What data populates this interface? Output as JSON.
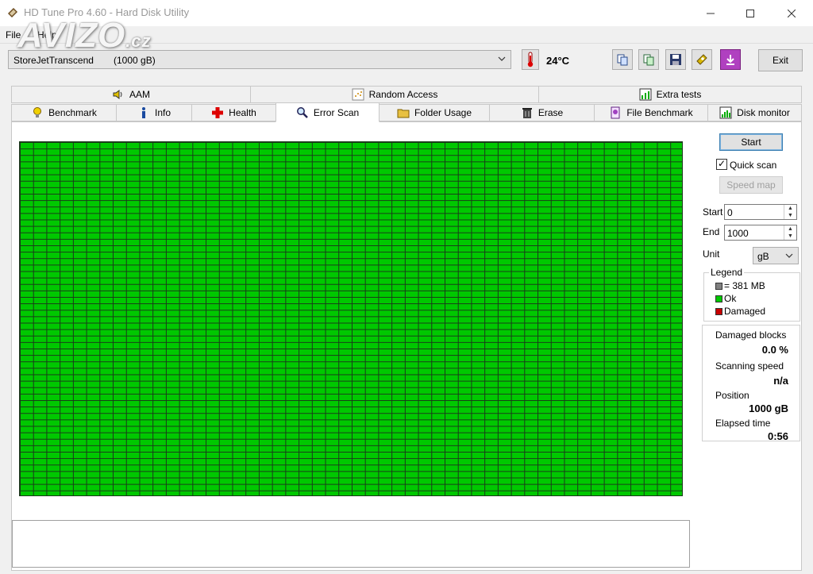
{
  "window": {
    "title": "HD Tune Pro 4.60 - Hard Disk Utility",
    "watermark": "AVIZO",
    "watermark_suffix": ".cz"
  },
  "menu": [
    "File",
    "Help"
  ],
  "toolbar": {
    "drive_name": "StoreJetTranscend",
    "drive_size": "(1000 gB)",
    "temperature": "24°C",
    "exit_label": "Exit",
    "icons": [
      "copy-info-icon",
      "copy-screenshot-icon",
      "save-icon",
      "options-icon",
      "download-icon"
    ]
  },
  "tabs": {
    "row1": [
      "AAM",
      "Random Access",
      "Extra tests"
    ],
    "row2": [
      "Benchmark",
      "Info",
      "Health",
      "Error Scan",
      "Folder Usage",
      "Erase",
      "File Benchmark",
      "Disk monitor"
    ],
    "active": "Error Scan"
  },
  "scan": {
    "block_state": "ok",
    "colors": {
      "ok": "#00c800",
      "damaged": "#c80000",
      "unscanned": "#808080",
      "grid_line": "#1a3a1a"
    }
  },
  "sidebar": {
    "start_button": "Start",
    "quick_scan_label": "Quick scan",
    "quick_scan_checked": true,
    "speed_map_button": "Speed map",
    "start_label": "Start",
    "start_value": "0",
    "end_label": "End",
    "end_value": "1000",
    "unit_label": "Unit",
    "unit_value": "gB"
  },
  "legend": {
    "title": "Legend",
    "block_size": "= 381 MB",
    "ok": "Ok",
    "damaged": "Damaged"
  },
  "stats": {
    "damaged_label": "Damaged blocks",
    "damaged_value": "0.0 %",
    "speed_label": "Scanning speed",
    "speed_value": "n/a",
    "position_label": "Position",
    "position_value": "1000 gB",
    "elapsed_label": "Elapsed time",
    "elapsed_value": "0:56"
  }
}
